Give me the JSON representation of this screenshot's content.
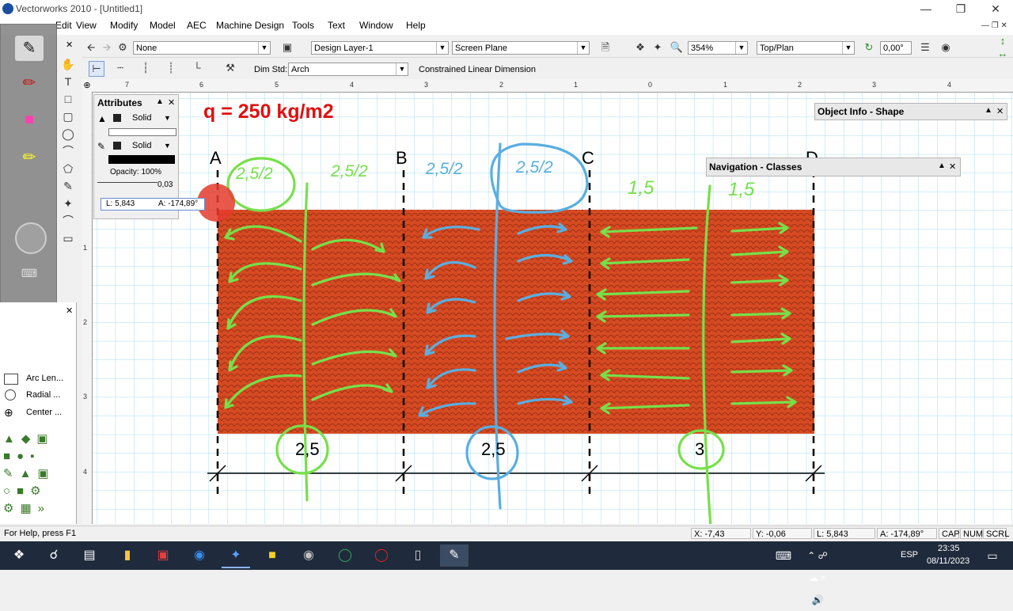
{
  "window": {
    "title": "Vectorworks 2010 - [Untitled1]",
    "controls": [
      "minimize",
      "restore",
      "close"
    ]
  },
  "menu": [
    "Edit",
    "View",
    "Modify",
    "Model",
    "AEC",
    "Machine Design",
    "Tools",
    "Text",
    "Window",
    "Help"
  ],
  "view_bar": {
    "class": "None",
    "layer": "Design Layer-1",
    "plane": "Screen Plane",
    "zoom": "354%",
    "view": "Top/Plan",
    "rotation": "0,00°"
  },
  "mode_bar": {
    "dim_std_label": "Dim Std:",
    "dim_std_value": "Arch",
    "mode_name": "Constrained Linear Dimension"
  },
  "ruler": {
    "top": [
      "7",
      "6",
      "5",
      "4",
      "3",
      "2",
      "1",
      "0",
      "1",
      "2",
      "3",
      "4"
    ],
    "left": [
      "1",
      "2",
      "3",
      "4"
    ]
  },
  "attributes": {
    "title": "Attributes",
    "fill": "Solid",
    "pen": "Solid",
    "opacity": "Opacity: 100%",
    "line_weight": "0,03",
    "tooltip_length": "L: 5,843",
    "tooltip_angle": "A: -174,89°"
  },
  "object_info": {
    "title": "Object Info - Shape"
  },
  "navigation": {
    "title": "Navigation - Classes"
  },
  "lower_tools": {
    "items": [
      "Arc Len...",
      "Radial ...",
      "Center ..."
    ]
  },
  "drawing": {
    "load_label": "q = 250 kg/m2",
    "axes": [
      "A",
      "B",
      "C",
      "D"
    ],
    "span_labels": [
      "2,5",
      "2,5",
      "3"
    ],
    "hand_notes_green": [
      "2,5/2",
      "2,5/2",
      "1,5",
      "1,5"
    ],
    "hand_notes_blue": [
      "2,5/2",
      "2,5/2"
    ],
    "fill_color": "#d64a22",
    "green_ink": "#76e04a",
    "blue_ink": "#5aaee0",
    "red_label": "#e01010"
  },
  "status": {
    "help": "For Help, press F1",
    "x": "X: -7,43",
    "y": "Y: -0,06",
    "l": "L: 5,843",
    "a": "A: -174,89°",
    "indicators": [
      "CAP",
      "NUM",
      "SCRL"
    ]
  },
  "taskbar": {
    "lang": "ESP",
    "time": "23:35",
    "date": "08/11/2023"
  }
}
